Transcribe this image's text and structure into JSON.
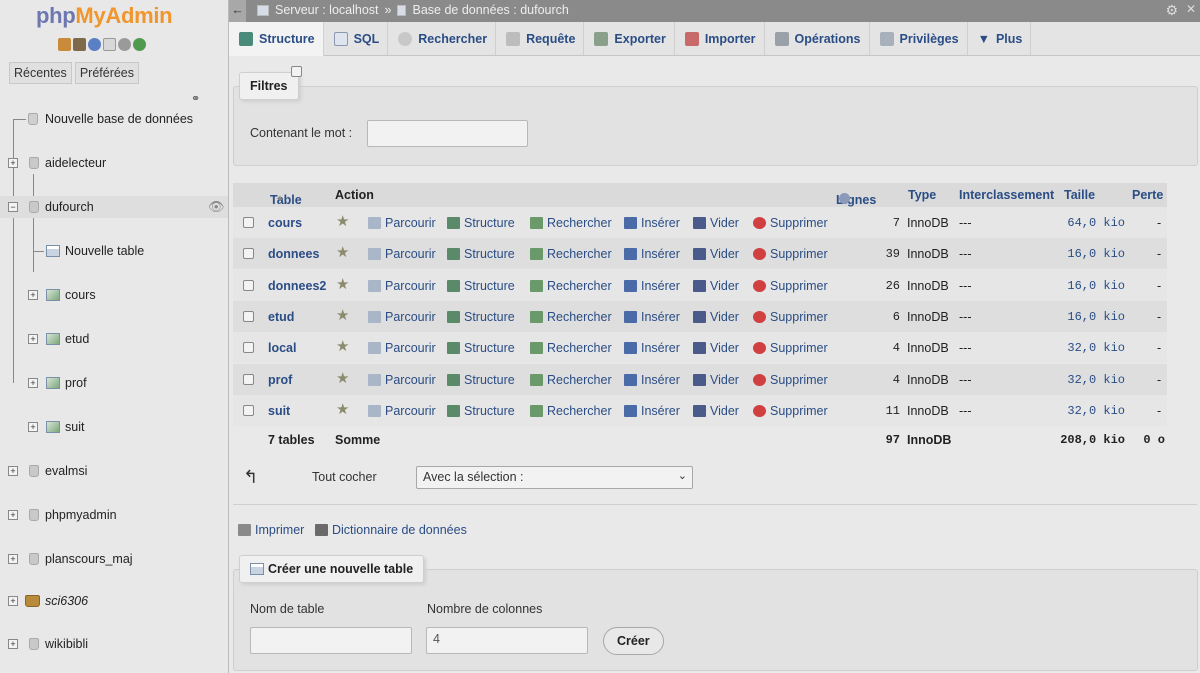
{
  "logo": {
    "part1": "php",
    "part2": "MyAdmin"
  },
  "nav": {
    "tabs": [
      "Récentes",
      "Préférées"
    ],
    "new_db": "Nouvelle base de données",
    "databases": [
      "aidelecteur",
      "dufourch",
      "evalmsi",
      "phpmyadmin",
      "planscours_maj",
      "sci6306",
      "wikibibli"
    ],
    "dufourch_children": {
      "new_table": "Nouvelle table",
      "tables": [
        "cours",
        "etud",
        "prof",
        "suit"
      ]
    }
  },
  "breadcrumb": {
    "server": "Serveur : localhost",
    "sep": "»",
    "database": "Base de données : dufourch"
  },
  "tabs": [
    "Structure",
    "SQL",
    "Rechercher",
    "Requête",
    "Exporter",
    "Importer",
    "Opérations",
    "Privilèges",
    "Plus"
  ],
  "filters": {
    "legend": "Filtres",
    "label": "Contenant le mot :",
    "value": ""
  },
  "table": {
    "headers": {
      "table": "Table",
      "sort_arrow": "▲",
      "action": "Action",
      "lignes": "Lignes",
      "type": "Type",
      "interclassement": "Interclassement",
      "taille": "Taille",
      "perte": "Perte"
    },
    "actions": {
      "parcourir": "Parcourir",
      "structure": "Structure",
      "rechercher": "Rechercher",
      "inserer": "Insérer",
      "vider": "Vider",
      "supprimer": "Supprimer"
    },
    "rows": [
      {
        "name": "cours",
        "rows": "7",
        "type": "InnoDB",
        "collation": "---",
        "size": "64,0 kio",
        "overhead": "-"
      },
      {
        "name": "donnees",
        "rows": "39",
        "type": "InnoDB",
        "collation": "---",
        "size": "16,0 kio",
        "overhead": "-"
      },
      {
        "name": "donnees2",
        "rows": "26",
        "type": "InnoDB",
        "collation": "---",
        "size": "16,0 kio",
        "overhead": "-"
      },
      {
        "name": "etud",
        "rows": "6",
        "type": "InnoDB",
        "collation": "---",
        "size": "16,0 kio",
        "overhead": "-"
      },
      {
        "name": "local",
        "rows": "4",
        "type": "InnoDB",
        "collation": "---",
        "size": "32,0 kio",
        "overhead": "-"
      },
      {
        "name": "prof",
        "rows": "4",
        "type": "InnoDB",
        "collation": "---",
        "size": "32,0 kio",
        "overhead": "-"
      },
      {
        "name": "suit",
        "rows": "11",
        "type": "InnoDB",
        "collation": "---",
        "size": "32,0 kio",
        "overhead": "-"
      }
    ],
    "summary": {
      "count": "7 tables",
      "label": "Somme",
      "rows": "97",
      "type": "InnoDB",
      "size": "208,0 kio",
      "overhead": "0 o"
    }
  },
  "bulk": {
    "check_all": "Tout cocher",
    "with_selection": "Avec la sélection :"
  },
  "links": {
    "print": "Imprimer",
    "dictionary": "Dictionnaire de données"
  },
  "create": {
    "legend": "Créer une nouvelle table",
    "name_label": "Nom de table",
    "name_value": "",
    "cols_label": "Nombre de colonnes",
    "cols_value": "4",
    "button": "Créer"
  },
  "colors": {
    "accent": "#2a4d85",
    "logo_php": "#6c78af",
    "logo_admin": "#f0962f"
  }
}
